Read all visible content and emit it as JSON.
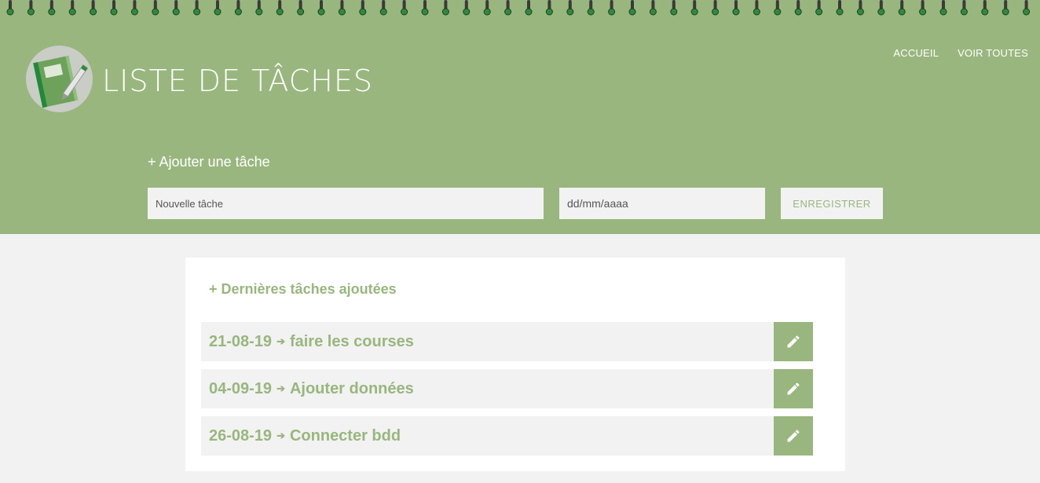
{
  "brand": {
    "title": "LISTE DE TÂCHES",
    "logo_icon": "notebook-pen-icon"
  },
  "nav": {
    "items": [
      {
        "label": "ACCUEIL"
      },
      {
        "label": "VOIR TOUTES"
      }
    ]
  },
  "add_form": {
    "heading": "+ Ajouter une tâche",
    "task_placeholder": "Nouvelle tâche",
    "date_placeholder": "dd/mm/aaaa",
    "save_label": "ENREGISTRER"
  },
  "recent": {
    "heading": "+ Dernières tâches ajoutées",
    "separator": "➔",
    "tasks": [
      {
        "date": "21-08-19",
        "name": "faire les courses"
      },
      {
        "date": "04-09-19",
        "name": "Ajouter données"
      },
      {
        "date": "26-08-19",
        "name": "Connecter bdd"
      }
    ],
    "edit_icon": "pencil-icon"
  },
  "colors": {
    "accent": "#99b67e",
    "background": "#f2f2f2",
    "panel": "#ffffff",
    "spiral": "#3a3a3a",
    "spiral_hole": "#2e8b3d"
  }
}
